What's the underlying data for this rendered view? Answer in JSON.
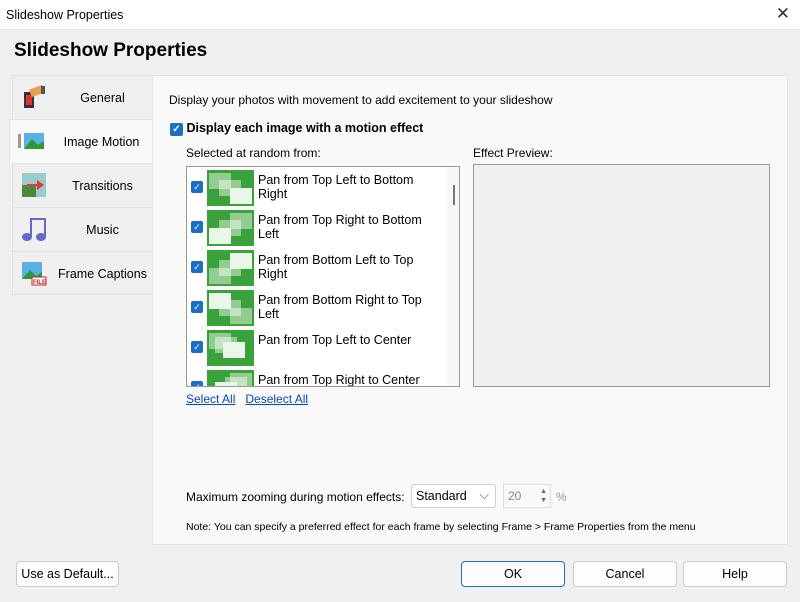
{
  "window": {
    "title": "Slideshow Properties",
    "close_glyph": "✕"
  },
  "heading": "Slideshow Properties",
  "tabs": [
    {
      "label": "General",
      "icon": "film-icon"
    },
    {
      "label": "Image Motion",
      "icon": "landscape-icon"
    },
    {
      "label": "Transitions",
      "icon": "transition-icon"
    },
    {
      "label": "Music",
      "icon": "music-note-icon"
    },
    {
      "label": "Frame Captions",
      "icon": "caption-file-icon"
    }
  ],
  "panel": {
    "description": "Display your photos with movement to add excitement to your slideshow",
    "motion_checkbox": {
      "label": "Display each image with a motion effect",
      "checked": true
    },
    "list_label": "Selected at random from:",
    "preview_label": "Effect Preview:",
    "effects": [
      {
        "label": "Pan from Top Left to Bottom Right",
        "checked": true
      },
      {
        "label": "Pan from Top Right to Bottom Left",
        "checked": true
      },
      {
        "label": "Pan from Bottom Left to Top Right",
        "checked": true
      },
      {
        "label": "Pan from Bottom Right to Top Left",
        "checked": true
      },
      {
        "label": "Pan from Top Left to Center",
        "checked": true
      },
      {
        "label": "Pan from Top Right to Center",
        "checked": true
      }
    ],
    "select_all": "Select All",
    "deselect_all": "Deselect All",
    "zoom_label": "Maximum zooming during motion effects:",
    "zoom_select": "Standard",
    "zoom_value": "20",
    "zoom_unit": "%",
    "note": "Note: You can specify a preferred effect for each frame by selecting Frame > Frame Properties from the menu"
  },
  "buttons": {
    "default": "Use as Default...",
    "ok": "OK",
    "cancel": "Cancel",
    "help": "Help"
  },
  "colors": {
    "accent": "#1a6fc7",
    "thumb": "#3aa23a",
    "link": "#0b46c4"
  }
}
